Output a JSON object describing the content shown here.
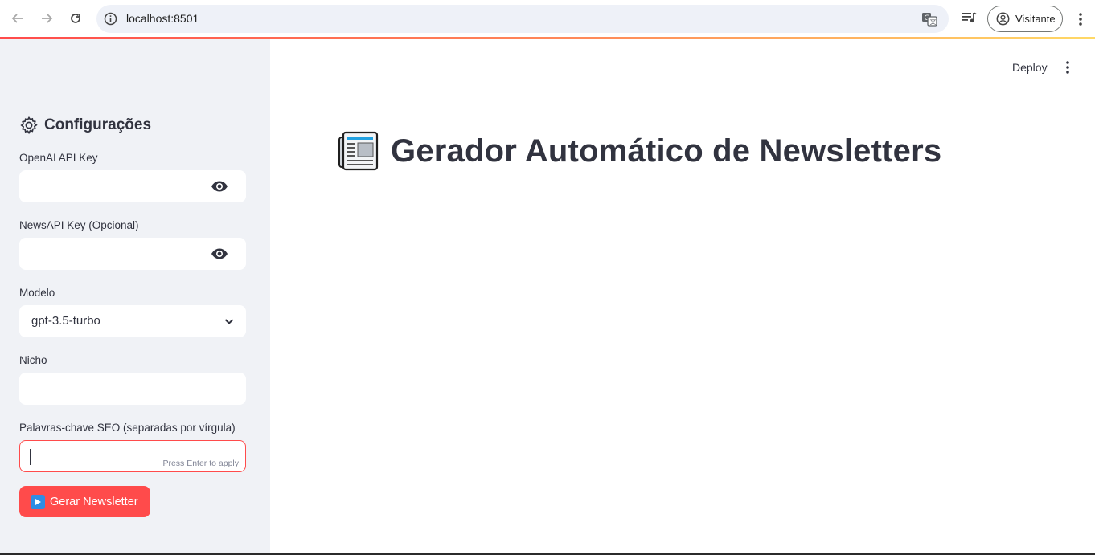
{
  "browser": {
    "url": "localhost:8501",
    "profile_label": "Visitante"
  },
  "sidebar": {
    "title": "Configurações",
    "fields": {
      "openai_label": "OpenAI API Key",
      "openai_value": "",
      "newsapi_label": "NewsAPI Key (Opcional)",
      "newsapi_value": "",
      "model_label": "Modelo",
      "model_value": "gpt-3.5-turbo",
      "niche_label": "Nicho",
      "niche_value": "",
      "keywords_label": "Palavras-chave SEO (separadas por vírgula)",
      "keywords_value": "",
      "keywords_hint": "Press Enter to apply"
    },
    "run_button_label": "Gerar Newsletter"
  },
  "main": {
    "deploy_label": "Deploy",
    "title": "Gerador Automático de Newsletters"
  },
  "colors": {
    "primary": "#ff4b4b",
    "sidebar_bg": "#f0f2f6",
    "text": "#31333f"
  }
}
